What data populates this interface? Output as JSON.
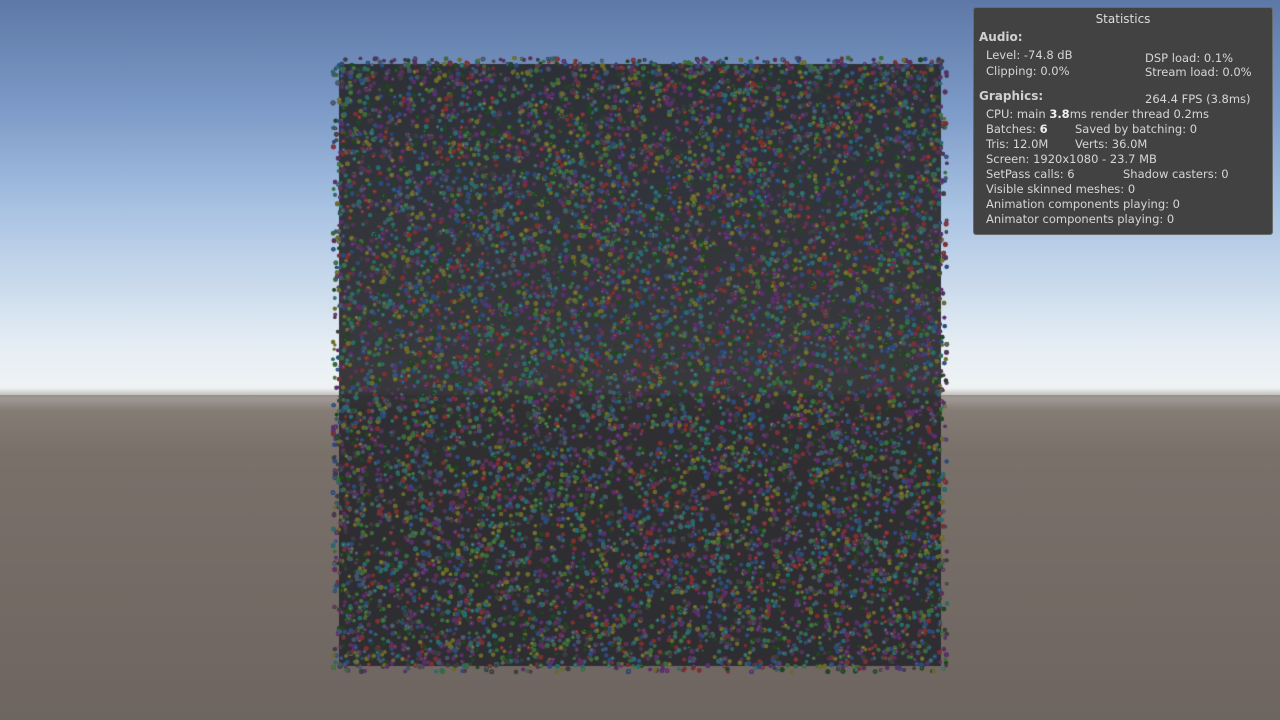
{
  "window": {
    "title": "Statistics"
  },
  "audio": {
    "header": "Audio:",
    "level": "Level: -74.8 dB",
    "clipping": "Clipping: 0.0%",
    "dsp_load": "DSP load: 0.1%",
    "stream_load": "Stream load: 0.0%"
  },
  "graphics": {
    "header": "Graphics:",
    "fps": "264.4 FPS (3.8ms)",
    "cpu_prefix": "CPU: main ",
    "cpu_main": "3.8",
    "cpu_suffix": "ms  render thread 0.2ms",
    "batches_prefix": "Batches: ",
    "batches_value": "6",
    "saved_by_batching": "Saved by batching: 0",
    "tris": "Tris: 12.0M",
    "verts": "Verts: 36.0M",
    "screen": "Screen: 1920x1080 - 23.7 MB",
    "setpass": "SetPass calls: 6",
    "shadow_casters": "Shadow casters: 0",
    "visible_skinned": "Visible skinned meshes: 0",
    "animation_components": "Animation components playing: 0",
    "animator_components": "Animator components playing: 0"
  },
  "scene": {
    "sky_top_color": "#5d78a6",
    "horizon_color": "#f2f4f3",
    "ground_color": "#6e6560",
    "particle_colors": [
      "#3a6b3a",
      "#5a2f6a",
      "#2c4a7a",
      "#7a3030",
      "#6a6a2a",
      "#2a6a6a",
      "#553355",
      "#445566",
      "#3d3d3d",
      "#224422"
    ]
  }
}
